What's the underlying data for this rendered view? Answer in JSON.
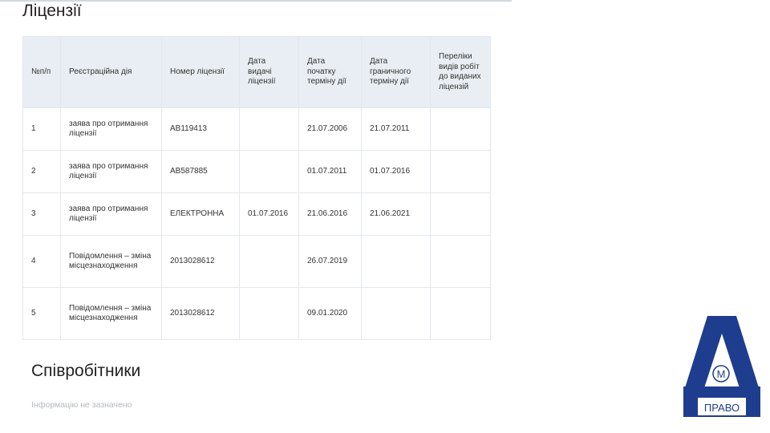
{
  "licenses": {
    "title": "Ліцензії",
    "columns": [
      "№п/п",
      "Реєстраційна дія",
      "Номер ліцензії",
      "Дата видачі ліцензії",
      "Дата початку терміну дії",
      "Дата граничного терміну дії",
      "Переліки видів робіт до виданих ліцензій"
    ],
    "rows": [
      [
        "1",
        "заява про отримання ліцензії",
        "АВ119413",
        "",
        "21.07.2006",
        "21.07.2011",
        ""
      ],
      [
        "2",
        "заява про отримання ліцензії",
        "АВ587885",
        "",
        "01.07.2011",
        "01.07.2016",
        ""
      ],
      [
        "3",
        "заява про отримання ліцензії",
        "ЕЛЕКТРОННА",
        "01.07.2016",
        "21.06.2016",
        "21.06.2021",
        ""
      ],
      [
        "4",
        "Повідомлення – зміна місцезнаходження",
        "2013028612",
        "",
        "26.07.2019",
        "",
        ""
      ],
      [
        "5",
        "Повідомлення – зміна місцезнаходження",
        "2013028612",
        "",
        "09.01.2020",
        "",
        ""
      ]
    ]
  },
  "staff": {
    "title": "Співробітники",
    "empty_text": "Інформацію не зазначено"
  },
  "logo": {
    "letter_m": "М",
    "caption": "ПРАВО",
    "color": "#1f3d8f"
  }
}
